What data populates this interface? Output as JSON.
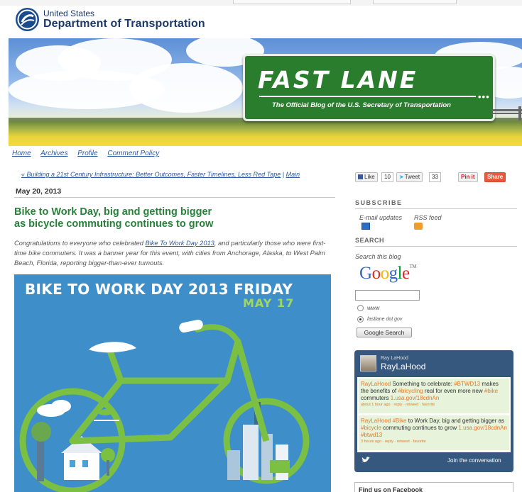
{
  "header": {
    "agency_line1": "United States",
    "agency_line2": "Department of Transportation"
  },
  "banner": {
    "title": "FAST LANE",
    "subtitle": "The Official Blog of the U.S. Secretary of Transportation",
    "dots": "•••"
  },
  "nav": {
    "items": [
      "Home",
      "Archives",
      "Profile",
      "Comment Policy"
    ]
  },
  "post": {
    "breadcrumb_prev": "« Building a 21st Century Infrastructure: Better Outcomes, Faster Timelines, Less Red Tape",
    "breadcrumb_sep": " | ",
    "breadcrumb_main": "Main",
    "date": "May 20, 2013",
    "title_line1": "Bike to Work Day, big and getting bigger",
    "title_line2": "as bicycle commuting continues to grow",
    "body_pre": "Congratulations to everyone who celebrated ",
    "body_link": "Bike To Work Day 2013",
    "body_post": ", and particularly those who were first-time bike commuters. It was a banner year for this event, with cities from Anchorage, Alaska, to West Palm Beach, Florida, reporting bigger-than-ever turnouts."
  },
  "hero": {
    "title": "BIKE TO WORK DAY 2013 FRIDAY",
    "date": "MAY 17"
  },
  "share": {
    "like_label": "Like",
    "like_count": "10",
    "tweet_label": "Tweet",
    "tweet_count": "33",
    "pin_label": "Pin it",
    "share_label": "Share"
  },
  "sidebar": {
    "subscribe_heading": "SUBSCRIBE",
    "email_label": "E-mail updates",
    "rss_label": "RSS feed",
    "search_heading": "SEARCH",
    "search_label": "Search this blog",
    "google_letters": [
      "G",
      "o",
      "o",
      "g",
      "l",
      "e"
    ],
    "google_tm": "TM",
    "radio_www": "www",
    "radio_site": "fastlane dot gov",
    "search_button": "Google Search",
    "search_value": "",
    "facebook_heading": "Find us on Facebook"
  },
  "twitter": {
    "handle_small": "Ray LaHood",
    "handle": "RayLaHood",
    "tweets": [
      {
        "user": "RayLaHood",
        "t1": " Something to celebrate: ",
        "tag1": "#BTWD13",
        "t2": " makes the benefits of ",
        "tag2": "#bicycling",
        "t3": " real for even more new ",
        "tag3": "#bike",
        "t4": " commuters ",
        "link": "1.usa.gov/18cdnAn",
        "meta": "about 1 hour ago · reply · retweet · favorite"
      },
      {
        "user": "RayLaHood",
        "t1": " ",
        "tag1": "#Bike",
        "t2": " to Work Day, big and getting bigger as ",
        "tag2": "#bicycle",
        "t3": " commuting continues to grow ",
        "tag3": "",
        "t4": "",
        "link": "1.usa.gov/18cdnAn #btwd13",
        "meta": "3 hours ago · reply · retweet · favorite"
      }
    ],
    "join_label": "Join the conversation"
  },
  "colors": {
    "dot_blue": "#1b3a6b",
    "sign_green": "#2b7d2e",
    "title_green": "#27813a",
    "link_blue": "#2c5aa0",
    "hero_blue": "#3e8fc9",
    "bike_green": "#7bc043",
    "twitter_navy": "#36587e",
    "tweet_orange": "#e8782a"
  }
}
